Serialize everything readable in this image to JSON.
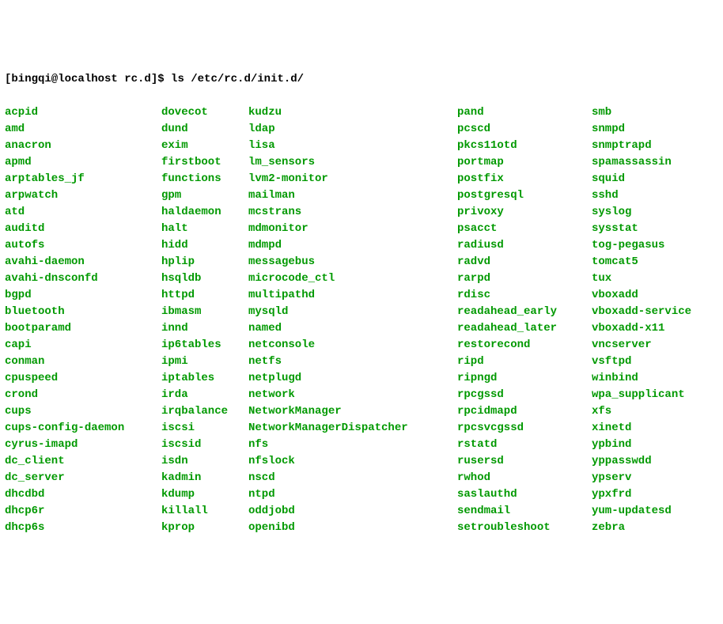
{
  "prompt": {
    "user_host": "[bingqi@localhost rc.d]$ ",
    "command": "ls /etc/rc.d/init.d/"
  },
  "cols": [
    [
      "acpid",
      "amd",
      "anacron",
      "apmd",
      "arptables_jf",
      "arpwatch",
      "atd",
      "auditd",
      "autofs",
      "avahi-daemon",
      "avahi-dnsconfd",
      "bgpd",
      "bluetooth",
      "bootparamd",
      "capi",
      "conman",
      "cpuspeed",
      "crond",
      "cups",
      "cups-config-daemon",
      "cyrus-imapd",
      "dc_client",
      "dc_server",
      "dhcdbd",
      "dhcp6r",
      "dhcp6s"
    ],
    [
      "dovecot",
      "dund",
      "exim",
      "firstboot",
      "functions",
      "gpm",
      "haldaemon",
      "halt",
      "hidd",
      "hplip",
      "hsqldb",
      "httpd",
      "ibmasm",
      "innd",
      "ip6tables",
      "ipmi",
      "iptables",
      "irda",
      "irqbalance",
      "iscsi",
      "iscsid",
      "isdn",
      "kadmin",
      "kdump",
      "killall",
      "kprop"
    ],
    [
      "kudzu",
      "ldap",
      "lisa",
      "lm_sensors",
      "lvm2-monitor",
      "mailman",
      "mcstrans",
      "mdmonitor",
      "mdmpd",
      "messagebus",
      "microcode_ctl",
      "multipathd",
      "mysqld",
      "named",
      "netconsole",
      "netfs",
      "netplugd",
      "network",
      "NetworkManager",
      "NetworkManagerDispatcher",
      "nfs",
      "nfslock",
      "nscd",
      "ntpd",
      "oddjobd",
      "openibd"
    ],
    [
      "pand",
      "pcscd",
      "pkcs11otd",
      "portmap",
      "postfix",
      "postgresql",
      "privoxy",
      "psacct",
      "radiusd",
      "radvd",
      "rarpd",
      "rdisc",
      "readahead_early",
      "readahead_later",
      "restorecond",
      "ripd",
      "ripngd",
      "rpcgssd",
      "rpcidmapd",
      "rpcsvcgssd",
      "rstatd",
      "rusersd",
      "rwhod",
      "saslauthd",
      "sendmail",
      "setroubleshoot"
    ],
    [
      "smb",
      "snmpd",
      "snmptrapd",
      "spamassassin",
      "squid",
      "sshd",
      "syslog",
      "sysstat",
      "tog-pegasus",
      "tomcat5",
      "tux",
      "vboxadd",
      "vboxadd-service",
      "vboxadd-x11",
      "vncserver",
      "vsftpd",
      "winbind",
      "wpa_supplicant",
      "xfs",
      "xinetd",
      "ypbind",
      "yppasswdd",
      "ypserv",
      "ypxfrd",
      "yum-updatesd",
      "zebra"
    ]
  ]
}
